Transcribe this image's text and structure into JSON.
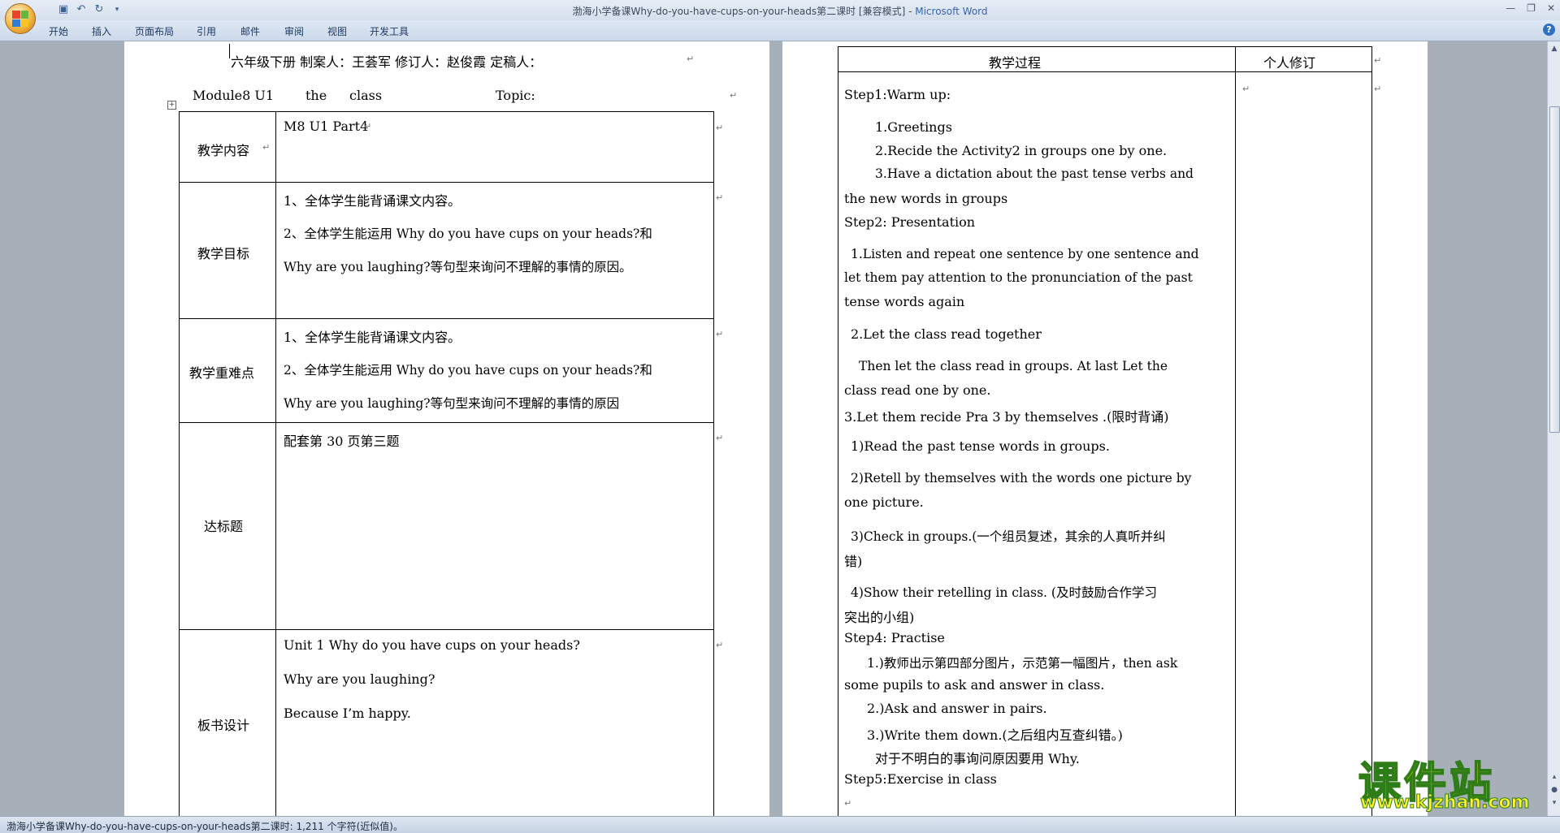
{
  "window": {
    "title_doc": "渤海小学备课Why-do-you-have-cups-on-your-heads第二课时 [兼容模式]",
    "title_sep": " - ",
    "title_app": "Microsoft Word"
  },
  "ribbon": {
    "tabs": [
      "开始",
      "插入",
      "页面布局",
      "引用",
      "邮件",
      "审阅",
      "视图",
      "开发工具"
    ]
  },
  "left_page": {
    "header": "六年级下册   制案人：王荟军      修订人：赵俊霞      定稿人：",
    "module_name": "Module8 U1",
    "module_the": "the",
    "module_class": "class",
    "topic_label": "Topic:",
    "rows": [
      {
        "label": "教学内容",
        "lines": [
          "M8 U1 Part4"
        ]
      },
      {
        "label": "教学目标",
        "lines": [
          "1、全体学生能背诵课文内容。",
          "2、全体学生能运用 Why do you have cups on your heads?和",
          "Why are you laughing?等句型来询问不理解的事情的原因。"
        ]
      },
      {
        "label": "教学重难点",
        "lines": [
          "1、全体学生能背诵课文内容。",
          "2、全体学生能运用 Why do you have cups on your heads?和",
          "Why are you laughing?等句型来询问不理解的事情的原因"
        ]
      },
      {
        "label": "达标题",
        "lines": [
          "配套第 30 页第三题"
        ]
      },
      {
        "label": "板书设计",
        "lines": [
          "Unit 1 Why do you have cups on your heads?",
          "Why are you laughing?",
          "Because I’m happy."
        ]
      }
    ]
  },
  "right_page": {
    "header_process": "教学过程",
    "header_revision": "个人修订",
    "lines": [
      "Step1:Warm up:",
      "1.Greetings",
      "2.Recide  the Activity2 in groups one by one.",
      "3.Have a dictation about the past tense verbs and",
      "the new words in groups",
      "Step2: Presentation",
      "1.Listen and repeat one sentence by one sentence and",
      "let them pay attention to the pronunciation of the past",
      "tense words again",
      "2.Let the class read together",
      "Then  let the class read in groups. At last Let the",
      "class read one by one.",
      "3.Let them recide Pra 3 by themselves .(限时背诵)",
      "1)Read the past tense words in groups.",
      "2)Retell by themselves with the words one picture by",
      "one picture.",
      "3)Check in groups.(一个组员复述，其余的人真听并纠",
      "错)",
      "4)Show their retelling in class. (及时鼓励合作学习",
      "突出的小组)",
      "Step4: Practise",
      "1.)教师出示第四部分图片，示范第一幅图片，then ask",
      "some pupils to ask and answer in class.",
      "2.)Ask and answer in pairs.",
      "3.)Write them down.(之后组内互查纠错。)",
      "对于不明白的事询问原因要用 Why.",
      "Step5:Exercise in class"
    ]
  },
  "status_bar": "渤海小学备课Why-do-you-have-cups-on-your-heads第二课时: 1,211 个字符(近似值)。",
  "watermark": {
    "text": "课件站",
    "url": "www.kjzhan.com"
  }
}
